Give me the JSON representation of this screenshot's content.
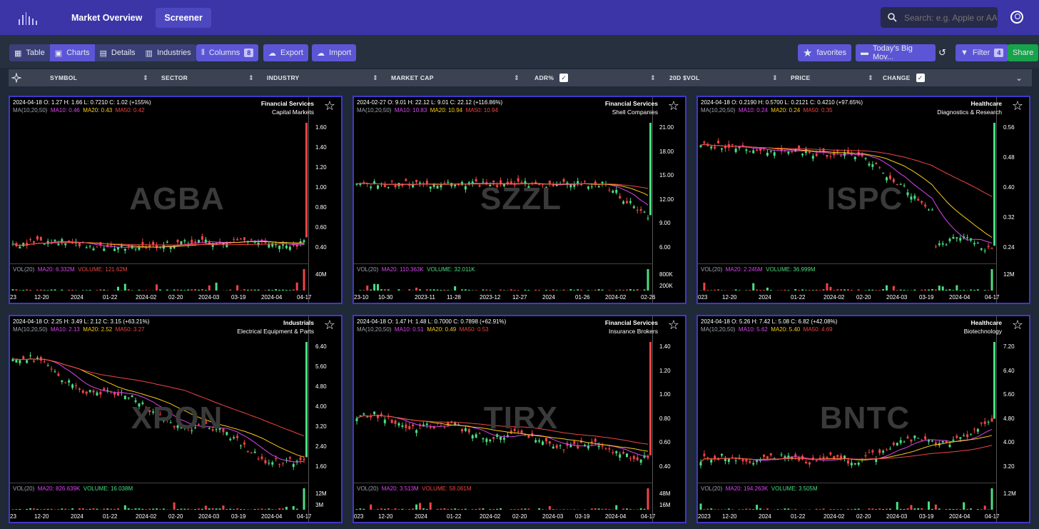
{
  "nav": {
    "links": [
      "Market Overview",
      "Screener"
    ],
    "search_placeholder": "Search: e.g. Apple or AAPL"
  },
  "toolbar": {
    "view_tabs": [
      "Table",
      "Charts",
      "Details",
      "Industries"
    ],
    "columns_label": "Columns",
    "columns_count": "8",
    "export_label": "Export",
    "import_label": "Import",
    "favorites_label": "favorites",
    "screen_label": "Today's Big Mov...",
    "filter_label": "Filter",
    "filter_count": "4",
    "share_label": "Share"
  },
  "columns": [
    "SYMBOL",
    "SECTOR",
    "INDUSTRY",
    "MARKET CAP",
    "ADR%",
    "20D $VOL",
    "PRICE",
    "CHANGE"
  ],
  "cards": [
    {
      "ticker": "AGBA",
      "ohlc": "2024-04-18   O: 1.27   H: 1.66   L: 0.7210   C: 1.02 (+155%)",
      "ma_label": "MA(10,20,50)",
      "ma10": "MA10: 0.46",
      "ma20": "MA20: 0.43",
      "ma50": "MA50: 0.42",
      "sector": "Financial Services",
      "industry": "Capital Markets",
      "vol_label": "VOL(20)",
      "vol_ma": "MA20: 6.332M",
      "vol_val": "VOLUME: 121.62M",
      "vol_dir": "down",
      "yticks": [
        "1.60",
        "1.40",
        "1.20",
        "1.00",
        "0.80",
        "0.60",
        "0.40"
      ],
      "vticks": [
        "40M"
      ],
      "xticks": [
        "23",
        "12-20",
        "2024",
        "01-22",
        "2024-02",
        "02-20",
        "2024-03",
        "03-19",
        "2024-04",
        "04-17"
      ]
    },
    {
      "ticker": "SZZL",
      "ohlc": "2024-02-27   O: 9.01   H: 22.12   L: 9.01   C: 22.12 (+116.86%)",
      "ma_label": "MA(10,20,50)",
      "ma10": "MA10: 10.83",
      "ma20": "MA20: 10.94",
      "ma50": "MA50: 10.94",
      "sector": "Financial Services",
      "industry": "Shell Companies",
      "vol_label": "VOL(20)",
      "vol_ma": "MA20: 110.363K",
      "vol_val": "VOLUME: 32.011K",
      "vol_dir": "up",
      "yticks": [
        "21.00",
        "18.00",
        "15.00",
        "12.00",
        "9.00",
        "6.00"
      ],
      "vticks": [
        "800K",
        "200K"
      ],
      "xticks": [
        "23-10",
        "10-30",
        "2023-11",
        "11-28",
        "2023-12",
        "12-27",
        "2024",
        "01-26",
        "2024-02",
        "02-26"
      ]
    },
    {
      "ticker": "ISPC",
      "ohlc": "2024-04-18   O: 0.2190   H: 0.5700   L: 0.2121   C: 0.4210 (+97.65%)",
      "ma_label": "MA(10,20,50)",
      "ma10": "MA10: 0.24",
      "ma20": "MA20: 0.24",
      "ma50": "MA50: 0.35",
      "sector": "Healthcare",
      "industry": "Diagnostics & Research",
      "vol_label": "VOL(20)",
      "vol_ma": "MA20: 2.245M",
      "vol_val": "VOLUME: 36.999M",
      "vol_dir": "up",
      "yticks": [
        "0.56",
        "0.48",
        "0.40",
        "0.32",
        "0.24"
      ],
      "vticks": [
        "12M"
      ],
      "xticks": [
        "023",
        "12-20",
        "2024",
        "01-22",
        "2024-02",
        "02-20",
        "2024-03",
        "03-19",
        "2024-04",
        "04-17"
      ]
    },
    {
      "ticker": "XPON",
      "ohlc": "2024-04-18   O: 2.25   H: 3.49   L: 2.12   C: 3.15 (+63.21%)",
      "ma_label": "MA(10,20,50)",
      "ma10": "MA10: 2.13",
      "ma20": "MA20: 2.52",
      "ma50": "MA50: 3.27",
      "sector": "Industrials",
      "industry": "Electrical Equipment & Parts",
      "vol_label": "VOL(20)",
      "vol_ma": "MA20: 826.639K",
      "vol_val": "VOLUME: 16.038M",
      "vol_dir": "up",
      "yticks": [
        "6.40",
        "5.60",
        "4.80",
        "4.00",
        "3.20",
        "2.40",
        "1.60"
      ],
      "vticks": [
        "12M",
        "3M"
      ],
      "xticks": [
        "23",
        "12-20",
        "2024",
        "01-22",
        "2024-02",
        "02-20",
        "2024-03",
        "03-19",
        "2024-04",
        "04-17"
      ]
    },
    {
      "ticker": "TIRX",
      "ohlc": "2024-04-18   O: 1.47   H: 1.48   L: 0.7000   C: 0.7898 (+62.91%)",
      "ma_label": "MA(10,20,50)",
      "ma10": "MA10: 0.51",
      "ma20": "MA20: 0.49",
      "ma50": "MA50: 0.53",
      "sector": "Financial Services",
      "industry": "Insurance Brokers",
      "vol_label": "VOL(20)",
      "vol_ma": "MA20: 3.513M",
      "vol_val": "VOLUME: 58.061M",
      "vol_dir": "down",
      "yticks": [
        "1.40",
        "1.20",
        "1.00",
        "0.80",
        "0.60",
        "0.40"
      ],
      "vticks": [
        "48M",
        "16M"
      ],
      "xticks": [
        "023",
        "12-20",
        "2024",
        "01-22",
        "2024-02",
        "02-20",
        "2024-03",
        "03-19",
        "2024-04",
        "04-17"
      ]
    },
    {
      "ticker": "BNTC",
      "ohlc": "2024-04-18   O: 5.26   H: 7.42   L: 5.08   C: 6.82 (+42.08%)",
      "ma_label": "MA(10,20,50)",
      "ma10": "MA10: 5.62",
      "ma20": "MA20: 5.40",
      "ma50": "MA50: 4.69",
      "sector": "Healthcare",
      "industry": "Biotechnology",
      "vol_label": "VOL(20)",
      "vol_ma": "MA20: 194.263K",
      "vol_val": "VOLUME: 3.505M",
      "vol_dir": "up",
      "yticks": [
        "7.20",
        "6.40",
        "5.60",
        "4.80",
        "4.00",
        "3.20"
      ],
      "vticks": [
        "1.2M"
      ],
      "xticks": [
        "2023",
        "12-20",
        "2024",
        "01-22",
        "2024-02",
        "02-20",
        "2024-03",
        "03-19",
        "2024-04",
        "04-17"
      ]
    }
  ]
}
